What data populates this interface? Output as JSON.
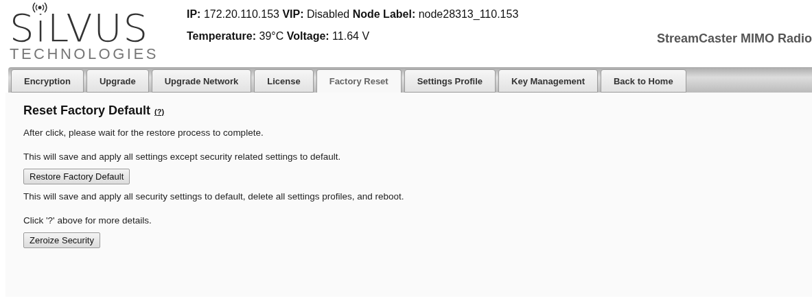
{
  "logo": {
    "name": "SiLVUS",
    "subtitle": "TECHNOLOGIES"
  },
  "info_lines": [
    "**IP:** 172.20.110.153 **VIP:** Disabled **Node Label:** node28313_110.153",
    "**Temperature:** 39°C **Voltage:** 11.64 V"
  ],
  "product": "StreamCaster MIMO Radio",
  "tabs": [
    {
      "label": "Encryption",
      "selected": false
    },
    {
      "label": "Upgrade",
      "selected": false
    },
    {
      "label": "Upgrade Network",
      "selected": false
    },
    {
      "label": "License",
      "selected": false
    },
    {
      "label": "Factory Reset",
      "selected": true
    },
    {
      "label": "Settings Profile",
      "selected": false
    },
    {
      "label": "Key Management",
      "selected": false
    },
    {
      "label": "Back to Home",
      "selected": false
    }
  ],
  "section": {
    "title": "Reset Factory Default",
    "help_link": "(?)"
  },
  "content": [
    {
      "kind": "text",
      "text": "After click, please wait for the restore process to complete."
    },
    {
      "kind": "text",
      "text": "This will save and apply all settings except security related settings to default."
    },
    {
      "kind": "button",
      "text": "Restore Factory Default"
    },
    {
      "kind": "text",
      "text": "This will save and apply all security settings to default, delete all settings profiles, and reboot."
    },
    {
      "kind": "text",
      "text": "Click '?' above for more details."
    },
    {
      "kind": "button",
      "text": "Zeroize Security"
    }
  ]
}
